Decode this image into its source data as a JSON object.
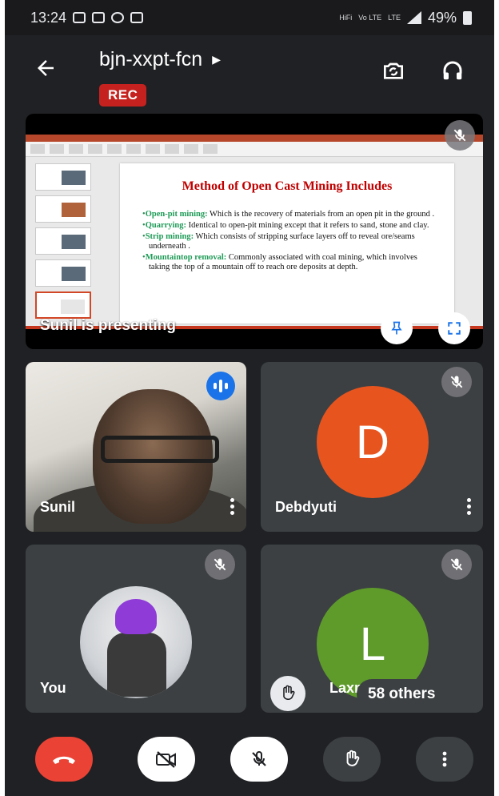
{
  "status_bar": {
    "time": "13:24",
    "net_label": "HiFi",
    "volte_label": "Vo LTE",
    "lte_label": "LTE",
    "battery": "49%"
  },
  "header": {
    "meeting_code": "bjn-xxpt-fcn",
    "rec_badge": "REC"
  },
  "presentation": {
    "slide_title": "Method of Open Cast Mining Includes",
    "bullets": [
      {
        "term": "Open-pit mining:",
        "text": " Which is the recovery of materials from an open pit in the ground ."
      },
      {
        "term": "Quarrying:",
        "text": " Identical to open-pit mining except that it refers to sand, stone and clay."
      },
      {
        "term": "Strip mining:",
        "text": " Which consists of stripping surface layers off to reveal ore/seams underneath ."
      },
      {
        "term": "Mountaintop removal:",
        "text": " Commonly associated with coal mining, which involves taking the top of a mountain off to reach ore deposits at depth."
      }
    ],
    "presenter_label": "Sunil is presenting"
  },
  "participants": {
    "sunil": {
      "name": "Sunil"
    },
    "debdyuti": {
      "name": "Debdyuti",
      "initial": "D",
      "color": "#e8541e"
    },
    "you": {
      "name": "You"
    },
    "laxmi": {
      "name": "Laxm",
      "initial": "L",
      "color": "#5e9b2b"
    }
  },
  "others_label": "58 others",
  "colors": {
    "end_call": "#ea4335",
    "rec": "#c5221f",
    "speaking": "#1a73e8"
  }
}
